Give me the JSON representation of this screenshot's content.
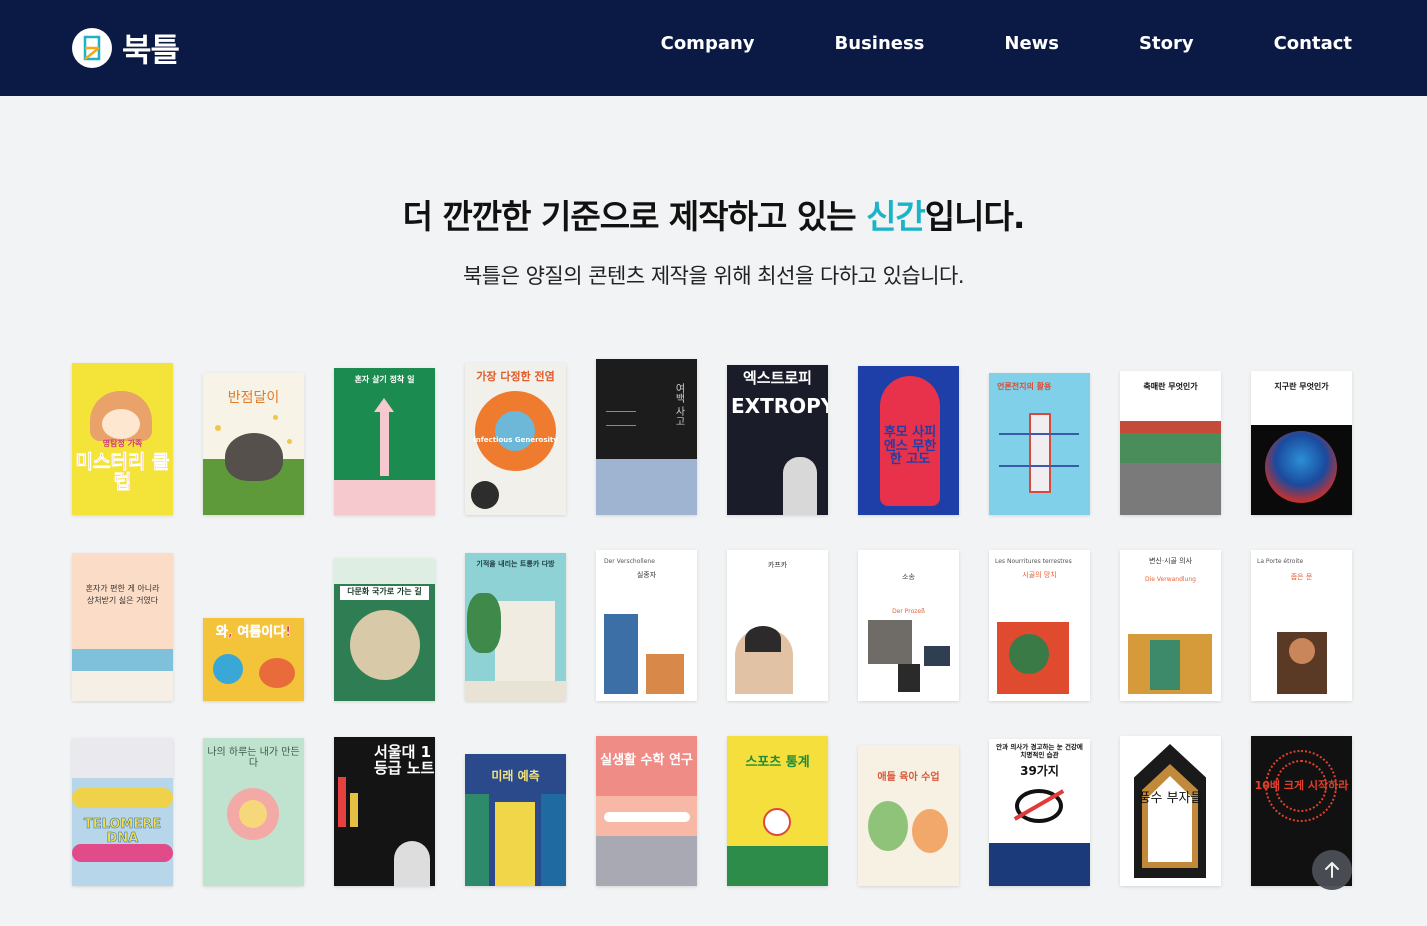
{
  "header": {
    "logo_text": "북틀",
    "nav": [
      "Company",
      "Business",
      "News",
      "Story",
      "Contact"
    ]
  },
  "hero": {
    "title_before": "더 깐깐한 기준으로 제작하고 있는 ",
    "title_accent": "신간",
    "title_after": "입니다.",
    "subtitle": "북틀은 양질의 콘텐츠 제작을 위해 최선을 다하고 있습니다.",
    "accent_color": "#1ab3c8"
  },
  "books": [
    {
      "title": "미스터리 클럽",
      "sub": "명탐정 가족"
    },
    {
      "title": "반점달이",
      "sub": ""
    },
    {
      "title": "혼자 살기 정착 일",
      "sub": ""
    },
    {
      "title": "가장 다정한 전염",
      "sub": "Infectious Generosity"
    },
    {
      "title": "여백 사고",
      "sub": ""
    },
    {
      "title": "엑스트로피",
      "sub": "EXTROPY"
    },
    {
      "title": "후모 사피엔스 무한한 고도",
      "sub": ""
    },
    {
      "title": "언론전지의 활용",
      "sub": ""
    },
    {
      "title": "축매란 무엇인가",
      "sub": ""
    },
    {
      "title": "지구란 무엇인가",
      "sub": ""
    },
    {
      "title": "혼자가 편한 게 아니라 상처받기 싫은 거였다",
      "sub": ""
    },
    {
      "title": "와, 여름이다!",
      "sub": ""
    },
    {
      "title": "다문화 국가로 가는 길",
      "sub": ""
    },
    {
      "title": "기적을 내리는 트롱카 다방",
      "sub": ""
    },
    {
      "title": "실종자",
      "sub": "Der Verschollene"
    },
    {
      "title": "카프카",
      "sub": ""
    },
    {
      "title": "소송",
      "sub": "Der Prozeß"
    },
    {
      "title": "시골의 망치",
      "sub": "Les Nourritures terrestres"
    },
    {
      "title": "변신·시골 의사",
      "sub": "Die Verwandlung"
    },
    {
      "title": "좁은 문",
      "sub": "La Porte étroite"
    },
    {
      "title": "TELOMERE DNA",
      "sub": ""
    },
    {
      "title": "나의 하루는 내가 만든다",
      "sub": ""
    },
    {
      "title": "서울대 1등급 노트",
      "sub": ""
    },
    {
      "title": "미래 예측",
      "sub": ""
    },
    {
      "title": "실생활 수학 연구",
      "sub": ""
    },
    {
      "title": "스포츠 통계",
      "sub": ""
    },
    {
      "title": "애들 육아 수업",
      "sub": ""
    },
    {
      "title": "39가지",
      "sub": "안과 의사가 경고하는 눈 건강에 치명적인 습관"
    },
    {
      "title": "풍수 부자들",
      "sub": ""
    },
    {
      "title": "10배 크게 시작하라",
      "sub": ""
    }
  ],
  "scroll_top_icon": "arrow-up-icon"
}
